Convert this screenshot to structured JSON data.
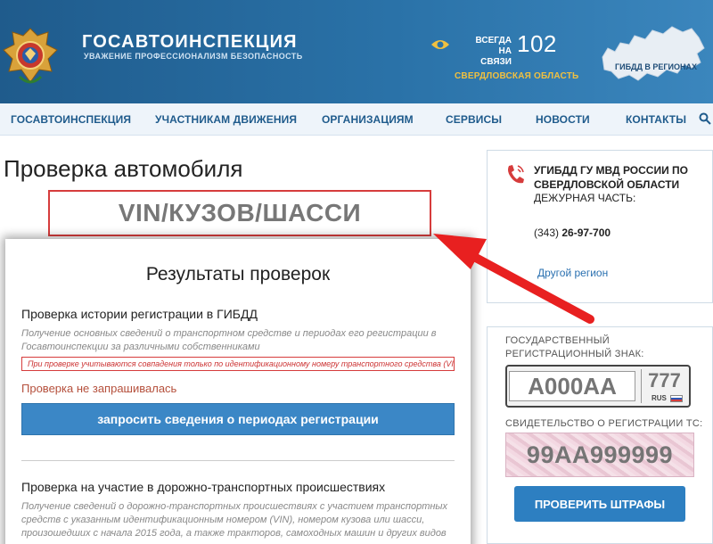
{
  "header": {
    "org_title": "ГОСАВТОИНСПЕКЦИЯ",
    "org_motto": "УВАЖЕНИЕ ПРОФЕССИОНАЛИЗМ БЕЗОПАСНОСТЬ",
    "always_line1": "ВСЕГДА",
    "always_line2": "НА СВЯЗИ",
    "hotline": "102",
    "region": "СВЕРДЛОВСКАЯ ОБЛАСТЬ",
    "map_label": "ГИБДД В РЕГИОНАХ"
  },
  "nav": {
    "items": [
      "ГОСАВТОИНСПЕКЦИЯ",
      "УЧАСТНИКАМ ДВИЖЕНИЯ",
      "ОРГАНИЗАЦИЯМ",
      "СЕРВИСЫ",
      "НОВОСТИ",
      "КОНТАКТЫ"
    ]
  },
  "main": {
    "page_title": "Проверка автомобиля",
    "vin_label": "VIN/КУЗОВ/ШАССИ",
    "results_title": "Результаты проверок",
    "section1": {
      "title": "Проверка истории регистрации в ГИБДД",
      "desc": "Получение основных сведений о транспортном средстве и периодах его регистрации в Госавтоинспекции за различными собственниками",
      "warning": "При проверке учитываются совпадения только по идентификационному номеру транспортного средства (VIN)",
      "status": "Проверка не запрашивалась",
      "button": "запросить сведения о периодах регистрации"
    },
    "section2": {
      "title": "Проверка на участие в дорожно-транспортных происшествиях",
      "desc": "Получение сведений о дорожно-транспортных происшествиях с участием транспортных средств с указанным идентификационным номером (VIN), номером кузова или шасси, произошедших с начала 2015 года, а также тракторов, самоходных машин и других видов"
    }
  },
  "sidebar": {
    "contact": {
      "org": "УГИБДД ГУ МВД РОССИИ ПО СВЕРДЛОВСКОЙ ОБЛАСТИ",
      "duty_label": "ДЕЖУРНАЯ ЧАСТЬ:",
      "duty_phone_prefix": "(343) ",
      "duty_phone": "26-97-700",
      "other_region": "Другой регион"
    },
    "plate": {
      "label": "ГОСУДАРСТВЕННЫЙ РЕГИСТРАЦИОННЫЙ ЗНАК:",
      "number_placeholder": "А000АА",
      "region_placeholder": "777",
      "rus": "RUS",
      "cert_label": "СВИДЕТЕЛЬСТВО О РЕГИСТРАЦИИ ТС:",
      "cert_placeholder": "99АА999999",
      "fines_button": "ПРОВЕРИТЬ ШТРАФЫ"
    }
  },
  "colors": {
    "header_blue": "#2a72a8",
    "accent_gold": "#f0c040",
    "highlight_red": "#d63c3c",
    "button_blue": "#3b87c6"
  }
}
